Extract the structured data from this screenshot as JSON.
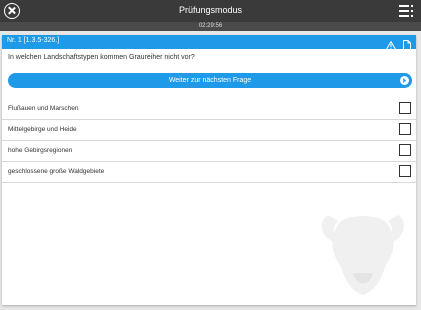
{
  "header": {
    "title": "Prüfungsmodus",
    "close_icon": "close-icon",
    "menu_icon": "menu-icon"
  },
  "timer": "02:29:56",
  "question": {
    "number": "Nr. 1 [1.3.5-326.]",
    "text": "In welchen Landschaftstypen kommen Graureiher nicht vor?",
    "warning_icon": "warning-icon",
    "document_icon": "document-icon"
  },
  "next_button": {
    "label": "Weiter zur nächsten Frage",
    "icon": "arrow-right-icon"
  },
  "answers": [
    {
      "label": "Flußauen und Marschen",
      "checked": false
    },
    {
      "label": "Mittelgebirge und Heide",
      "checked": false
    },
    {
      "label": "hohe Gebirgsregionen",
      "checked": false
    },
    {
      "label": "geschlossene große Waldgebiete",
      "checked": false
    }
  ],
  "colors": {
    "accent": "#1e9ae8",
    "topbar": "#3a3a3a",
    "background": "#e6e6e6"
  }
}
